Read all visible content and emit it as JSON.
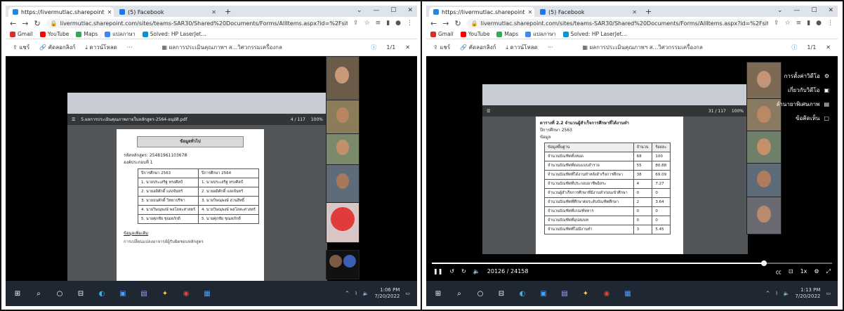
{
  "left": {
    "tabs": [
      {
        "label": "https://livermutlac.sharepoint",
        "color": "#1e88e5"
      },
      {
        "label": "(5) Facebook",
        "color": "#1877f2"
      }
    ],
    "url": "livermutlac.sharepoint.com/sites/teams-SAR30/Shared%20Documents/Forms/AllItems.aspx?id=%2Fsites%2Fteams-SAR30%2FShared%20Documents...",
    "bookmarks": [
      "Gmail",
      "YouTube",
      "Maps",
      "แปลภาษา",
      "Solved: HP LaserJet..."
    ],
    "viewer": {
      "share": "แชร์",
      "copy_link": "คัดลอกลิงก์",
      "download": "ดาวน์โหลด",
      "more": "···",
      "filename": "ผลการประเมินคุณภาพฯ ส...วิศวกรรมเครื่องกล",
      "page": "1/1"
    },
    "shared": {
      "pdf_name": "5.ผลการประเมินคุณภาพภายในหลักสูตร-2564-อนุมัติ.pdf",
      "pdf_page": "4 / 117",
      "zoom": "100%",
      "header_box": "ข้อมูลทั่วไป",
      "course_code": "รหัสหลักสูตร: 25481961103678",
      "section": "องค์ประกอบที่ 1",
      "col1": "ปีการศึกษา 2563",
      "col2": "ปีการศึกษา 2564",
      "rows": [
        [
          "1. นายประเสริฐ ทรงศิลป์",
          "1. นายประเสริฐ ทรงศิลป์"
        ],
        [
          "2. นายอดิศักดิ์ แสงจันทร์",
          "2. นายอดิศักดิ์ แสงจันทร์"
        ],
        [
          "3. นายธนศักดิ์ วิทยาปรีชา",
          "3. นายวิษณุพงษ์ สวนสิทธิ์"
        ],
        [
          "4. นายวิษณุพงษ์ พลโลหะศาสตร์",
          "4. นายวิษณุพงษ์ พลโลหะศาสตร์"
        ],
        [
          "5. นายศุภชัย ชุณหภักดี",
          "5. นายศุภชัย ชุณหภักดี"
        ]
      ],
      "footer_heading": "ข้อมูลเพิ่มเติม",
      "footer_text": "การเปลี่ยนแปลงอาจารย์ผู้รับผิดชอบหลักสูตร"
    },
    "taskbar_time": "1:06 PM",
    "taskbar_date": "7/20/2022"
  },
  "right": {
    "tabs": [
      {
        "label": "https://livermutlac.sharepoint",
        "color": "#1e88e5"
      },
      {
        "label": "(5) Facebook",
        "color": "#1877f2"
      }
    ],
    "url": "livermutlac.sharepoint.com/sites/teams-SAR30/Shared%20Documents/Forms/AllItems.aspx?id=%2Fsites%2Fteams-SAR30%2FShared%20Documents...",
    "bookmarks": [
      "Gmail",
      "YouTube",
      "Maps",
      "แปลภาษา",
      "Solved: HP LaserJet..."
    ],
    "viewer": {
      "share": "แชร์",
      "copy_link": "คัดลอกลิงก์",
      "download": "ดาวน์โหลด",
      "more": "···",
      "filename": "ผลการประเมินคุณภาพฯ ส...วิศวกรรมเครื่องกล",
      "page": "1/1"
    },
    "menu": [
      "การตั้งค่าวิดีโอ",
      "เกี่ยวกับวิดีโอ",
      "ลำนายาพิเศษภาพ",
      "ข้อคิดเห็น"
    ],
    "shared": {
      "pdf_page": "31 / 117",
      "zoom": "100%",
      "table_title": "ตารางที่ 2.2  จำนวนผู้สำเร็จการศึกษาที่ได้งานทำ",
      "year": "ปีการศึกษา 2563",
      "subtitle": "ข้อมูล",
      "header": [
        "ข้อมูลพื้นฐาน",
        "จำนวน",
        "ร้อยละ"
      ],
      "rows": [
        [
          "จำนวนบัณฑิตทั้งหมด",
          "68",
          "100"
        ],
        [
          "จำนวนบัณฑิตที่ตอบแบบสำรวจ",
          "55",
          "80.88"
        ],
        [
          "จำนวนบัณฑิตที่ได้งานทำหลังสำเร็จการศึกษา",
          "38",
          "69.09"
        ],
        [
          "จำนวนบัณฑิตที่ประกอบอาชีพอิสระ",
          "4",
          "7.27"
        ],
        [
          "จำนวนผู้สำเร็จการศึกษาที่มีงานทำก่อนเข้าศึกษา",
          "0",
          "0"
        ],
        [
          "จำนวนบัณฑิตที่ศึกษาต่อระดับบัณฑิตศึกษา",
          "2",
          "3.64"
        ],
        [
          "จำนวนบัณฑิตที่เกณฑ์ทหาร",
          "0",
          "0"
        ],
        [
          "จำนวนบัณฑิตที่อุปสมบท",
          "0",
          "0"
        ],
        [
          "จำนวนบัณฑิตที่ไม่มีงานทำ",
          "3",
          "5.45"
        ]
      ]
    },
    "player": {
      "time": "20126 / 24158",
      "progress_pct": 83
    },
    "taskbar_time": "1:13 PM",
    "taskbar_date": "7/20/2022"
  }
}
